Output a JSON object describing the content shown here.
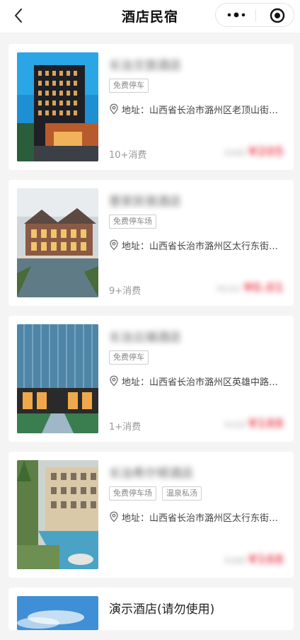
{
  "nav": {
    "title": "酒店民宿"
  },
  "hotels": [
    {
      "name": "长治文旅酒店",
      "tags": [
        "免费停车"
      ],
      "address": "地址：山西省长治市潞州区老顶山街道…",
      "consume": "10+消费",
      "orig_price": "¥268",
      "price": "¥205"
    },
    {
      "name": "壹家民宿酒店",
      "tags": [
        "免费停车场"
      ],
      "address": "地址：山西省长治市潞州区太行东街…",
      "consume": "9+消费",
      "orig_price": "¥0.01",
      "price": "¥0.01"
    },
    {
      "name": "长治云端酒店",
      "tags": [
        "免费停车"
      ],
      "address": "地址：山西省长治市潞州区英雄中路…",
      "consume": "1+消费",
      "orig_price": "¥218",
      "price": "¥188"
    },
    {
      "name": "长治希尔顿酒店",
      "tags": [
        "免费停车场",
        "温泉私汤"
      ],
      "address": "地址：山西省长治市潞州区太行东街…",
      "consume": "",
      "orig_price": "¥188",
      "price": "¥168"
    },
    {
      "name": "演示酒店(请勿使用)",
      "tags": [],
      "address": "",
      "consume": "",
      "orig_price": "",
      "price": ""
    }
  ],
  "colors": {
    "accent": "#e8303f",
    "background": "#f4f4f4"
  }
}
